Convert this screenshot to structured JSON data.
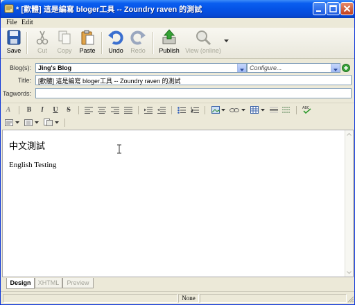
{
  "window": {
    "title": "* [歡體] 這是編寫 bloger工具 --  Zoundry raven 的測試"
  },
  "menu": {
    "items": [
      "File",
      "Edit"
    ]
  },
  "toolbar": {
    "save": "Save",
    "cut": "Cut",
    "copy": "Copy",
    "paste": "Paste",
    "undo": "Undo",
    "redo": "Redo",
    "publish": "Publish",
    "view_online": "View (online)"
  },
  "fields": {
    "blog_label": "Blog(s):",
    "blog_value": "Jing's Blog",
    "configure_value": "Configure...",
    "title_label": "Title:",
    "title_value": "[歡體] 這是編寫 bloger工具 --  Zoundry raven 的測試",
    "tagwords_label": "Tagwords:",
    "tagwords_value": ""
  },
  "editor": {
    "line1": "中文測試",
    "line2": "English Testing"
  },
  "tabs": {
    "design": "Design",
    "xhtml": "XHTML",
    "preview": "Preview",
    "active": "Design"
  },
  "status": {
    "text": "None"
  },
  "colors": {
    "titlebar": "#0553e6",
    "accent_green": "#3aa33a",
    "chrome": "#ece9d8"
  }
}
